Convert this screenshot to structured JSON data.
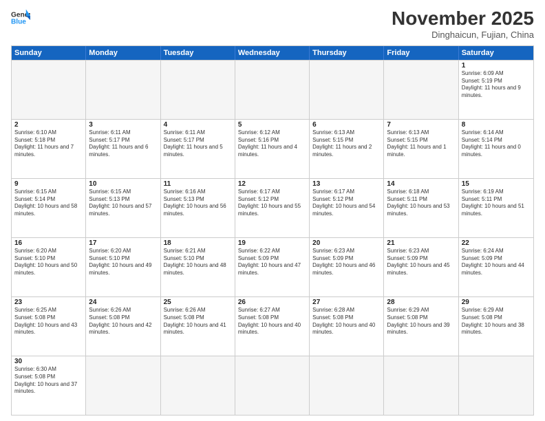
{
  "header": {
    "logo_general": "General",
    "logo_blue": "Blue",
    "month_title": "November 2025",
    "location": "Dinghaicun, Fujian, China"
  },
  "weekdays": [
    "Sunday",
    "Monday",
    "Tuesday",
    "Wednesday",
    "Thursday",
    "Friday",
    "Saturday"
  ],
  "rows": [
    [
      {
        "day": "",
        "info": ""
      },
      {
        "day": "",
        "info": ""
      },
      {
        "day": "",
        "info": ""
      },
      {
        "day": "",
        "info": ""
      },
      {
        "day": "",
        "info": ""
      },
      {
        "day": "",
        "info": ""
      },
      {
        "day": "1",
        "info": "Sunrise: 6:09 AM\nSunset: 5:19 PM\nDaylight: 11 hours and 9 minutes."
      }
    ],
    [
      {
        "day": "2",
        "info": "Sunrise: 6:10 AM\nSunset: 5:18 PM\nDaylight: 11 hours and 7 minutes."
      },
      {
        "day": "3",
        "info": "Sunrise: 6:11 AM\nSunset: 5:17 PM\nDaylight: 11 hours and 6 minutes."
      },
      {
        "day": "4",
        "info": "Sunrise: 6:11 AM\nSunset: 5:17 PM\nDaylight: 11 hours and 5 minutes."
      },
      {
        "day": "5",
        "info": "Sunrise: 6:12 AM\nSunset: 5:16 PM\nDaylight: 11 hours and 4 minutes."
      },
      {
        "day": "6",
        "info": "Sunrise: 6:13 AM\nSunset: 5:15 PM\nDaylight: 11 hours and 2 minutes."
      },
      {
        "day": "7",
        "info": "Sunrise: 6:13 AM\nSunset: 5:15 PM\nDaylight: 11 hours and 1 minute."
      },
      {
        "day": "8",
        "info": "Sunrise: 6:14 AM\nSunset: 5:14 PM\nDaylight: 11 hours and 0 minutes."
      }
    ],
    [
      {
        "day": "9",
        "info": "Sunrise: 6:15 AM\nSunset: 5:14 PM\nDaylight: 10 hours and 58 minutes."
      },
      {
        "day": "10",
        "info": "Sunrise: 6:15 AM\nSunset: 5:13 PM\nDaylight: 10 hours and 57 minutes."
      },
      {
        "day": "11",
        "info": "Sunrise: 6:16 AM\nSunset: 5:13 PM\nDaylight: 10 hours and 56 minutes."
      },
      {
        "day": "12",
        "info": "Sunrise: 6:17 AM\nSunset: 5:12 PM\nDaylight: 10 hours and 55 minutes."
      },
      {
        "day": "13",
        "info": "Sunrise: 6:17 AM\nSunset: 5:12 PM\nDaylight: 10 hours and 54 minutes."
      },
      {
        "day": "14",
        "info": "Sunrise: 6:18 AM\nSunset: 5:11 PM\nDaylight: 10 hours and 53 minutes."
      },
      {
        "day": "15",
        "info": "Sunrise: 6:19 AM\nSunset: 5:11 PM\nDaylight: 10 hours and 51 minutes."
      }
    ],
    [
      {
        "day": "16",
        "info": "Sunrise: 6:20 AM\nSunset: 5:10 PM\nDaylight: 10 hours and 50 minutes."
      },
      {
        "day": "17",
        "info": "Sunrise: 6:20 AM\nSunset: 5:10 PM\nDaylight: 10 hours and 49 minutes."
      },
      {
        "day": "18",
        "info": "Sunrise: 6:21 AM\nSunset: 5:10 PM\nDaylight: 10 hours and 48 minutes."
      },
      {
        "day": "19",
        "info": "Sunrise: 6:22 AM\nSunset: 5:09 PM\nDaylight: 10 hours and 47 minutes."
      },
      {
        "day": "20",
        "info": "Sunrise: 6:23 AM\nSunset: 5:09 PM\nDaylight: 10 hours and 46 minutes."
      },
      {
        "day": "21",
        "info": "Sunrise: 6:23 AM\nSunset: 5:09 PM\nDaylight: 10 hours and 45 minutes."
      },
      {
        "day": "22",
        "info": "Sunrise: 6:24 AM\nSunset: 5:09 PM\nDaylight: 10 hours and 44 minutes."
      }
    ],
    [
      {
        "day": "23",
        "info": "Sunrise: 6:25 AM\nSunset: 5:08 PM\nDaylight: 10 hours and 43 minutes."
      },
      {
        "day": "24",
        "info": "Sunrise: 6:26 AM\nSunset: 5:08 PM\nDaylight: 10 hours and 42 minutes."
      },
      {
        "day": "25",
        "info": "Sunrise: 6:26 AM\nSunset: 5:08 PM\nDaylight: 10 hours and 41 minutes."
      },
      {
        "day": "26",
        "info": "Sunrise: 6:27 AM\nSunset: 5:08 PM\nDaylight: 10 hours and 40 minutes."
      },
      {
        "day": "27",
        "info": "Sunrise: 6:28 AM\nSunset: 5:08 PM\nDaylight: 10 hours and 40 minutes."
      },
      {
        "day": "28",
        "info": "Sunrise: 6:29 AM\nSunset: 5:08 PM\nDaylight: 10 hours and 39 minutes."
      },
      {
        "day": "29",
        "info": "Sunrise: 6:29 AM\nSunset: 5:08 PM\nDaylight: 10 hours and 38 minutes."
      }
    ],
    [
      {
        "day": "30",
        "info": "Sunrise: 6:30 AM\nSunset: 5:08 PM\nDaylight: 10 hours and 37 minutes."
      },
      {
        "day": "",
        "info": ""
      },
      {
        "day": "",
        "info": ""
      },
      {
        "day": "",
        "info": ""
      },
      {
        "day": "",
        "info": ""
      },
      {
        "day": "",
        "info": ""
      },
      {
        "day": "",
        "info": ""
      }
    ]
  ]
}
